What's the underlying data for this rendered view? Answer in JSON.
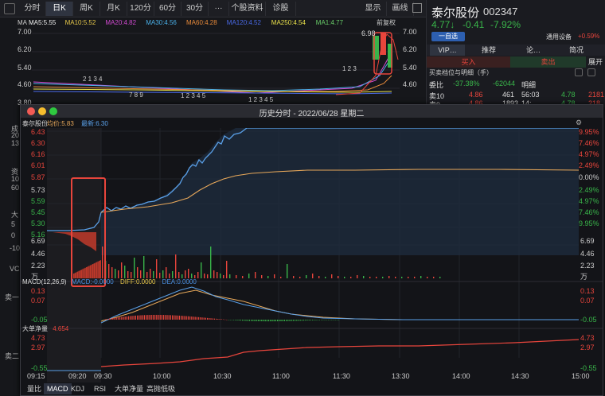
{
  "toolbar": {
    "tabs": [
      "分时",
      "日K",
      "周K",
      "月K",
      "120分",
      "60分",
      "30分",
      "···",
      "个股资料",
      "诊股",
      "显示",
      "画线"
    ],
    "active_index": 1
  },
  "ma_line": [
    {
      "text": "MA5:5.55",
      "color": "#f0f0f0"
    },
    {
      "text": "MA10:5.52",
      "color": "#e6c84a"
    },
    {
      "text": "MA20:4.82",
      "color": "#d04ad0"
    },
    {
      "text": "MA30:4.56",
      "color": "#4ab0e8"
    },
    {
      "text": "MA60:4.28",
      "color": "#e88a3a"
    },
    {
      "text": "MA120:4.52",
      "color": "#4a6ae8"
    },
    {
      "text": "MA250:4.54",
      "color": "#e8e04a"
    },
    {
      "text": "MA1:4.77",
      "color": "#6ad06a"
    }
  ],
  "ma_prefix": "MA",
  "qianfuquan": "前复权",
  "kline_axis": [
    "7.00",
    "6.20",
    "5.40",
    "4.60",
    "3.80"
  ],
  "kline_right_axis": [
    "7.00",
    "6.20",
    "5.40",
    "4.60"
  ],
  "kline_high_label": "6.98",
  "kline_markers": [
    "1 2 3",
    "2 1 3 4",
    "7 8 9",
    "1 2 3 4 5",
    "1 2 3 4 5",
    "1 2 3 4 5 6",
    "1 2 3"
  ],
  "left_strip": [
    "成",
    "20",
    "13",
    "资",
    "10",
    "60",
    "大",
    "5",
    "0",
    "-10",
    "VC",
    "卖一",
    "卖二"
  ],
  "stock": {
    "name": "泰尔股份",
    "code": "002347",
    "price": "4.77↓",
    "change": "-0.41",
    "pct": "-7.92%",
    "watch_button": "一自选",
    "industry": "通用设备",
    "industry_pct": "+0.59%"
  },
  "side_tabs": [
    "VIP…",
    "推荐",
    "论…",
    "简况"
  ],
  "side_buy_label": "买入",
  "side_sell_label": "卖出",
  "side_expand": "展开",
  "side_order_title": "买卖档位与明细（手）",
  "side_row1": {
    "label": "委比",
    "pct": "-37.38%",
    "diff": "-62044",
    "detail": "明细"
  },
  "side_row2": {
    "label": "卖10",
    "price": "4.86",
    "vol": "461",
    "time": "56:03",
    "p2": "4.78",
    "v2": "2181"
  },
  "side_row3": {
    "label": "卖9",
    "price": "4.86",
    "vol": "1893",
    "time": "14:",
    "p2": "4.78",
    "v2": "218"
  },
  "popup": {
    "title": "历史分时 - 2022/06/28 星期二",
    "name": "泰尔股份",
    "avg_label": "均价:5.83",
    "latest_label": "最新:6.30",
    "left_price_axis": [
      "6.43",
      "6.30",
      "6.16",
      "6.01",
      "5.87",
      "5.73",
      "5.59",
      "5.45",
      "5.30",
      "5.16"
    ],
    "right_pct_axis": [
      "9.95%",
      "7.46%",
      "4.97%",
      "2.49%",
      "0.00%",
      "2.49%",
      "4.97%",
      "7.46%",
      "9.95%"
    ],
    "vol_left_axis": [
      "6.69",
      "4.46",
      "2.23",
      "万"
    ],
    "vol_right_axis": [
      "6.69",
      "4.46",
      "2.23",
      "万"
    ],
    "macd_label": "MACD(12,26,9)",
    "macd_value": "MACD:-0.0000",
    "diff_value": "DIFF:0.0000",
    "dea_value": "DEA:0.0000",
    "macd_left_axis": [
      "0.13",
      "0.07",
      "-0.05"
    ],
    "macd_right_axis": [
      "0.13",
      "0.07",
      "-0.05"
    ],
    "big_label": "大单净量",
    "big_value": "4.654",
    "big_left_axis": [
      "4.73",
      "2.97",
      "-0.55"
    ],
    "big_right_axis": [
      "4.73",
      "2.97",
      "-0.55"
    ],
    "time_axis": [
      "09:15",
      "09:20",
      "09:30",
      "10:00",
      "10:30",
      "11:00",
      "11:30",
      "13:30",
      "14:00",
      "14:30",
      "15:00"
    ],
    "bottom_tabs": [
      "量比",
      "MACD",
      "KDJ",
      "RSI",
      "大单净量",
      "高抛低吸"
    ],
    "bottom_active": 1
  },
  "colors": {
    "up": "#e8453c",
    "down": "#39b54a",
    "price_line": "#5aa0e8",
    "avg_line": "#e8a85a",
    "highlight": "#e8453c"
  }
}
